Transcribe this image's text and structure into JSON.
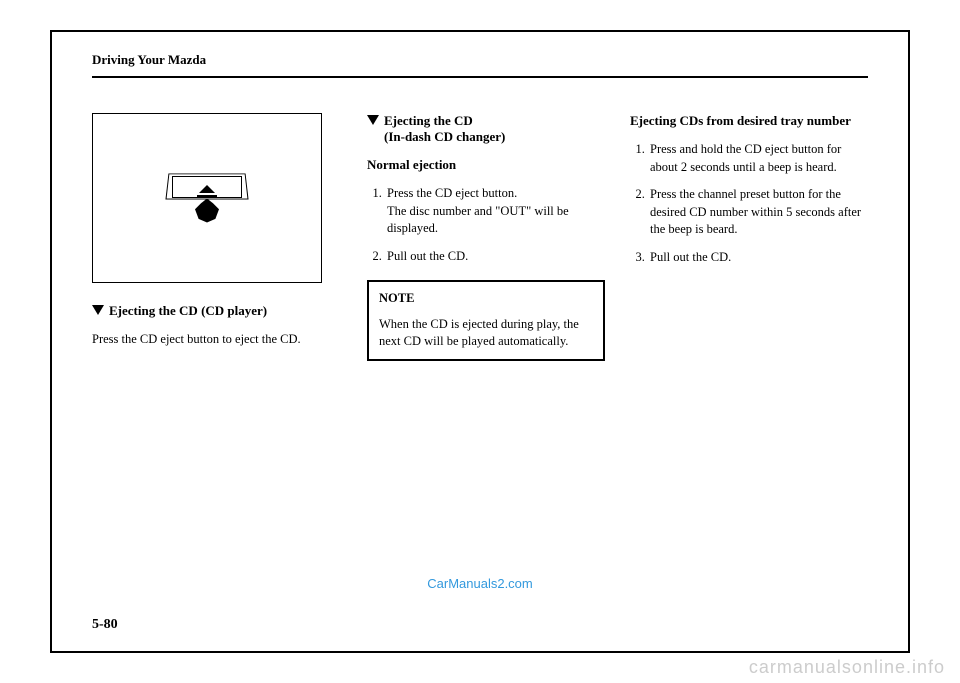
{
  "header": {
    "title": "Driving Your Mazda"
  },
  "col1": {
    "heading": "Ejecting the CD (CD player)",
    "text": "Press the CD eject button to eject the CD."
  },
  "col2": {
    "heading_line1": "Ejecting the CD",
    "heading_line2": "(In-dash CD changer)",
    "sub_heading": "Normal ejection",
    "step1_line1": "Press the CD eject button.",
    "step1_line2": "The disc number and \"OUT\" will be displayed.",
    "step2": "Pull out the CD.",
    "note_title": "NOTE",
    "note_text": "When the CD is ejected during play, the next CD will be played automatically."
  },
  "col3": {
    "heading": "Ejecting CDs from desired tray number",
    "step1": "Press and hold the CD eject button for about 2 seconds until a beep is heard.",
    "step2": "Press the channel preset button for the desired CD number within 5 seconds after the beep is beard.",
    "step3": "Pull out the CD."
  },
  "watermarks": {
    "blue": "CarManuals2.com",
    "bottom": "carmanualsonline.info"
  },
  "page_number": "5-80"
}
